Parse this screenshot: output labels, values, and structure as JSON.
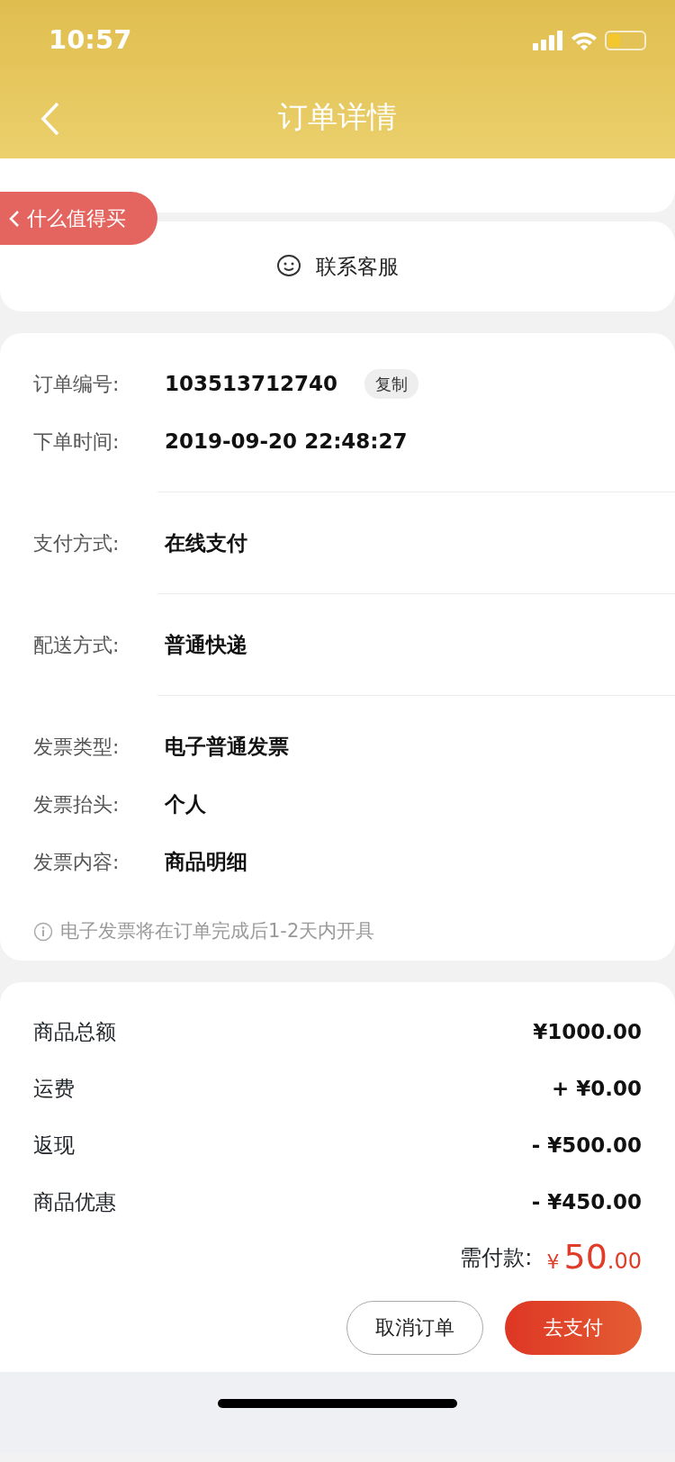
{
  "status_bar": {
    "time": "10:57"
  },
  "header": {
    "title": "订单详情"
  },
  "floating_tag": {
    "label": "什么值得买"
  },
  "contact": {
    "label": "联系客服"
  },
  "order_info": {
    "groups": [
      [
        {
          "label": "订单编号:",
          "value": "103513712740",
          "action": "复制"
        },
        {
          "label": "下单时间:",
          "value": "2019-09-20 22:48:27"
        }
      ],
      [
        {
          "label": "支付方式:",
          "value": "在线支付"
        }
      ],
      [
        {
          "label": "配送方式:",
          "value": "普通快递"
        }
      ],
      [
        {
          "label": "发票类型:",
          "value": "电子普通发票"
        },
        {
          "label": "发票抬头:",
          "value": "个人"
        },
        {
          "label": "发票内容:",
          "value": "商品明细"
        }
      ]
    ],
    "note": "电子发票将在订单完成后1-2天内开具"
  },
  "price_rows": [
    {
      "label": "商品总额",
      "value": "¥1000.00"
    },
    {
      "label": "运费",
      "value": "+ ¥0.00"
    },
    {
      "label": "返现",
      "value": "- ¥500.00"
    },
    {
      "label": "商品优惠",
      "value": "- ¥450.00"
    }
  ],
  "total": {
    "label": "需付款:",
    "currency": "¥",
    "integer": "50",
    "decimal": ".00"
  },
  "buttons": [
    {
      "label": "取消订单",
      "kind": "outline"
    },
    {
      "label": "去支付",
      "kind": "primary"
    }
  ]
}
